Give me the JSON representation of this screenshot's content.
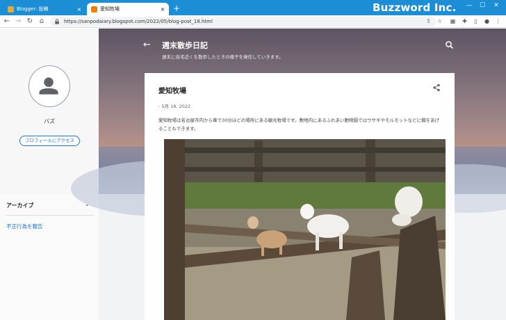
{
  "browser": {
    "tabs": [
      {
        "title": "Blogger: 投稿",
        "favicon_color": "#f4a62a"
      },
      {
        "title": "愛知牧場",
        "favicon_color": "#f57d00"
      }
    ],
    "new_tab": "+",
    "close_glyph": "×",
    "brand": "Buzzword Inc.",
    "url": "https://sanpodaiary.blogspot.com/2022/05/blog-post_18.html",
    "accent": "#1c8ed6"
  },
  "sidebar": {
    "profile_name": "バズ",
    "profile_button": "プロフィールにアクセス",
    "archive_label": "アーカイブ",
    "report_link": "不正行為を報告"
  },
  "blog": {
    "title": "週末散歩日記",
    "description": "週末に自宅近くを散歩したときの様子を発信していきます。"
  },
  "post": {
    "title": "愛知牧場",
    "date": "- 5月 18, 2022",
    "body": "愛知牧場は名古屋市内から車で30分ほどの場所にある観光牧場です。敷地内にあるふれあい動物園ではウサギやモルモットなどに餌をあげることもできます。"
  },
  "icons": {
    "back": "back-arrow-icon",
    "search": "search-icon",
    "share": "share-icon",
    "avatar": "person-icon"
  }
}
